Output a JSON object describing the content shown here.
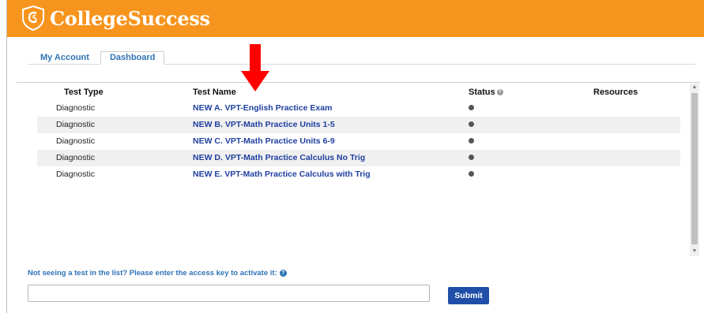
{
  "brand": {
    "name": "CollegeSuccess"
  },
  "tabs": [
    {
      "label": "My Account",
      "active": false
    },
    {
      "label": "Dashboard",
      "active": true
    }
  ],
  "table": {
    "headers": {
      "type": "Test Type",
      "name": "Test Name",
      "status": "Status",
      "resources": "Resources"
    },
    "rows": [
      {
        "type": "Diagnostic",
        "name": "NEW A. VPT-English Practice Exam"
      },
      {
        "type": "Diagnostic",
        "name": "NEW B. VPT-Math Practice Units 1-5"
      },
      {
        "type": "Diagnostic",
        "name": "NEW C. VPT-Math Practice Units 6-9"
      },
      {
        "type": "Diagnostic",
        "name": "NEW D. VPT-Math Practice Calculus No Trig"
      },
      {
        "type": "Diagnostic",
        "name": "NEW E. VPT-Math Practice Calculus with Trig"
      }
    ]
  },
  "access": {
    "prompt": "Not seeing a test in the list? Please enter the access key to activate it:",
    "input_value": "",
    "submit_label": "Submit"
  },
  "colors": {
    "header": "#f7941d",
    "link": "#1f3fa0",
    "tab_text": "#2e74b5",
    "submit": "#1f4fa8",
    "arrow": "#ff0000"
  },
  "icons": {
    "logo": "shield-logo-icon",
    "status_help": "help-icon",
    "access_help": "question-circle-icon",
    "status_dot": "status-dot-icon",
    "scroll_up": "chevron-up-icon",
    "scroll_down": "chevron-down-icon",
    "annotation": "red-down-arrow-icon"
  }
}
